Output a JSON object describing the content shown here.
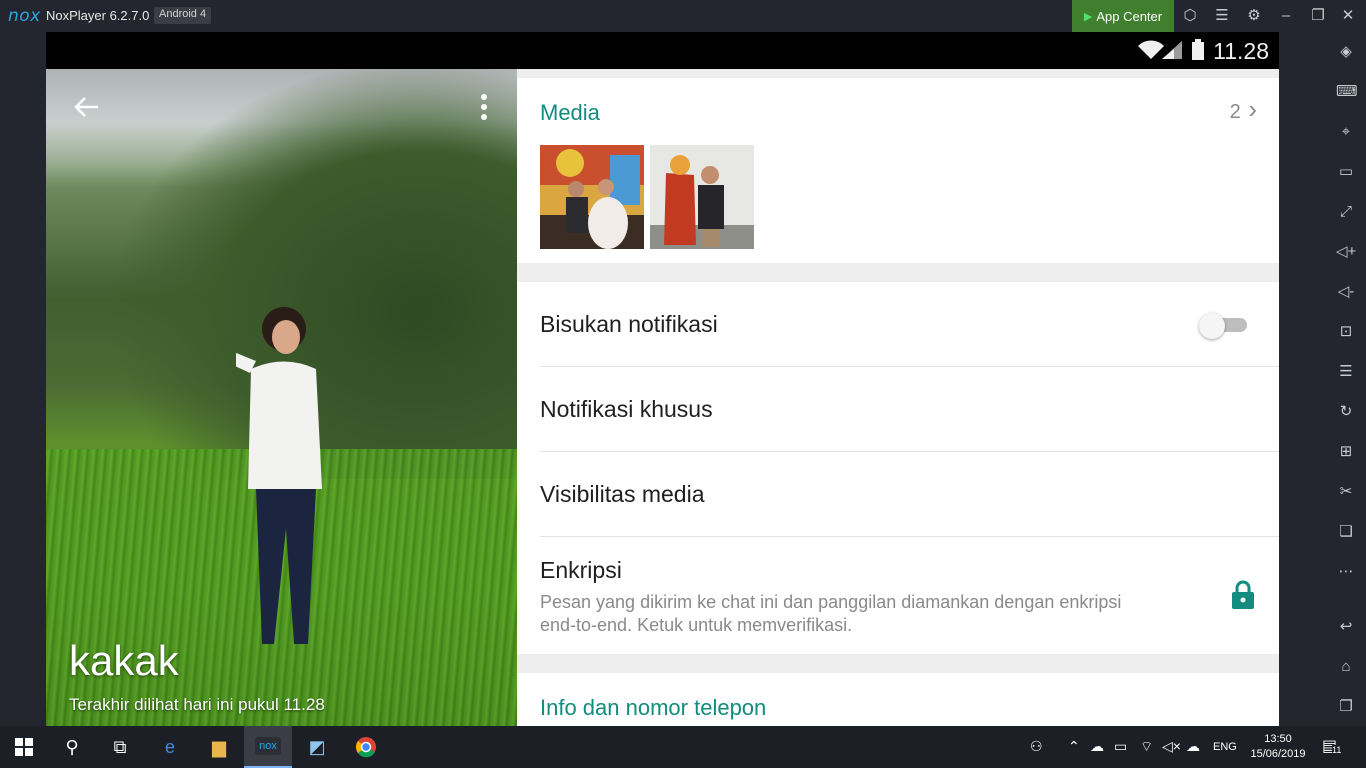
{
  "titlebar": {
    "logo": "nox",
    "app_name": "NoxPlayer 6.2.7.0",
    "android_badge": "Android 4",
    "app_center_label": "App Center",
    "icons": [
      "shirt-icon",
      "menu-icon",
      "gear-icon",
      "minimize-icon",
      "restore-icon",
      "close-icon"
    ]
  },
  "statusbar": {
    "time": "11.28",
    "icons": [
      "wifi-icon",
      "signal-icon",
      "battery-icon"
    ]
  },
  "profile": {
    "name": "kakak",
    "last_seen": "Terakhir dilihat hari ini pukul 11.28"
  },
  "media": {
    "title": "Media",
    "count": "2",
    "chevron": "›"
  },
  "settings": {
    "mute_label": "Bisukan notifikasi",
    "mute_enabled": false,
    "custom_notif_label": "Notifikasi khusus",
    "media_visibility_label": "Visibilitas media",
    "encryption_label": "Enkripsi",
    "encryption_desc": "Pesan yang dikirim ke chat ini dan panggilan diamankan dengan enkripsi end-to-end. Ketuk untuk memverifikasi."
  },
  "info": {
    "title": "Info dan nomor telepon"
  },
  "sidebar_icons": [
    "rotate-icon",
    "keyboard-icon",
    "location-icon",
    "screen-icon",
    "fullscreen-icon",
    "volume-up-icon",
    "volume-down-icon",
    "screenshot-icon",
    "shake-icon",
    "sync-icon",
    "apk-install-icon",
    "scissors-icon",
    "multi-instance-icon",
    "more-icon",
    "back-icon",
    "home-icon",
    "recent-apps-icon"
  ],
  "taskbar": {
    "lang": "ENG",
    "time": "13:50",
    "date": "15/06/2019",
    "notification_count": "11"
  },
  "colors": {
    "accent": "#128c7e",
    "lock": "#128c7e"
  }
}
